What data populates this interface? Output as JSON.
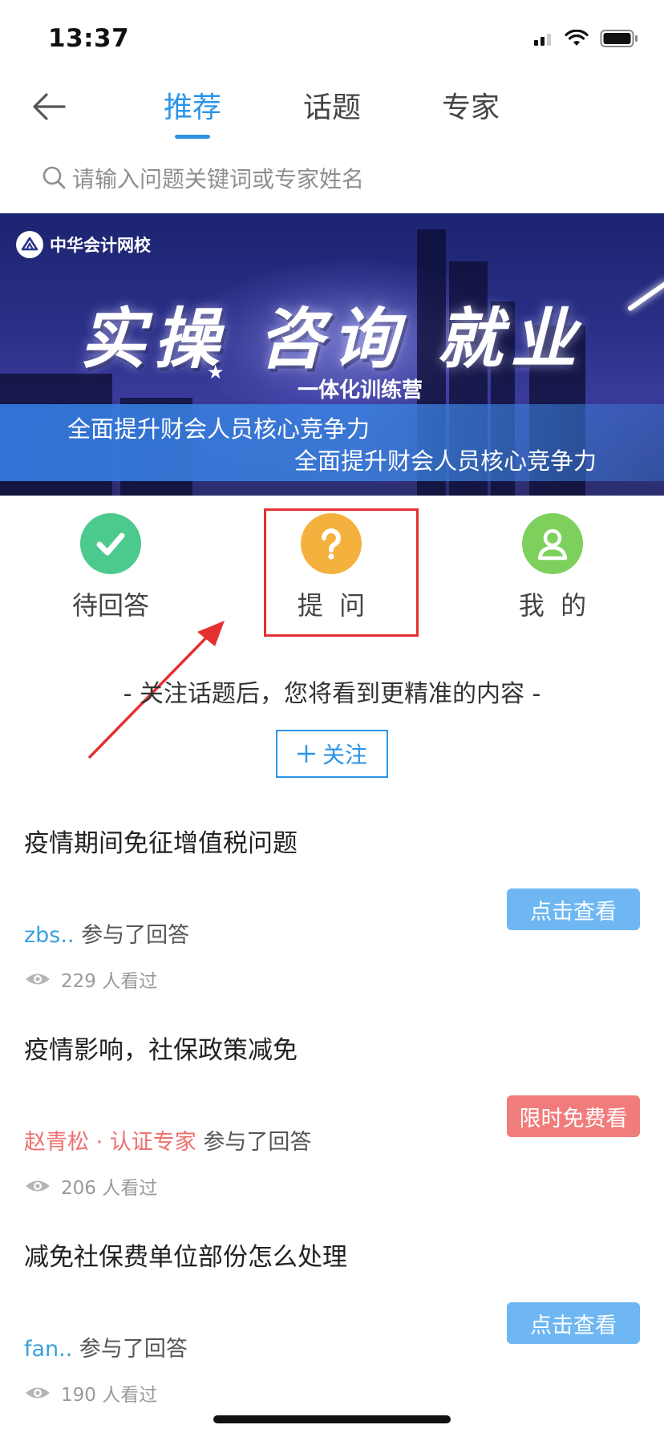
{
  "status_bar": {
    "time": "13:37"
  },
  "nav": {
    "tabs": [
      {
        "label": "推荐",
        "active": true
      },
      {
        "label": "话题",
        "active": false
      },
      {
        "label": "专家",
        "active": false
      }
    ]
  },
  "search": {
    "placeholder": "请输入问题关键词或专家姓名"
  },
  "banner": {
    "logo_text": "中华会计网校",
    "title": "实操 咨询 就业",
    "subtitle": "一体化训练营",
    "line1": "全面提升财会人员核心竞争力",
    "line2": "全面提升财会人员核心竞争力"
  },
  "actions": [
    {
      "label": "待回答",
      "icon": "check-icon",
      "color": "#4cc98c"
    },
    {
      "label": "提  问",
      "icon": "question-icon",
      "color": "#f5b13d"
    },
    {
      "label": "我  的",
      "icon": "user-icon",
      "color": "#7ed05c"
    }
  ],
  "follow": {
    "tip": "- 关注话题后，您将看到更精准的内容 -",
    "button_label": "关注"
  },
  "feed": [
    {
      "title": "疫情期间免征增值税问题",
      "user": "zbs..",
      "action_text": " 参与了回答",
      "views": "229 人看过",
      "badge": "点击查看",
      "badge_color": "#6eb7f2"
    },
    {
      "title": "疫情影响，社保政策减免",
      "user": "赵青松 · 认证专家",
      "action_text": " 参与了回答",
      "views": "206 人看过",
      "badge": "限时免费看",
      "badge_color": "#f17c7c"
    },
    {
      "title": "减免社保费单位部份怎么处理",
      "user": "fan..",
      "action_text": " 参与了回答",
      "views": "190 人看过",
      "badge": "点击查看",
      "badge_color": "#6eb7f2"
    }
  ]
}
